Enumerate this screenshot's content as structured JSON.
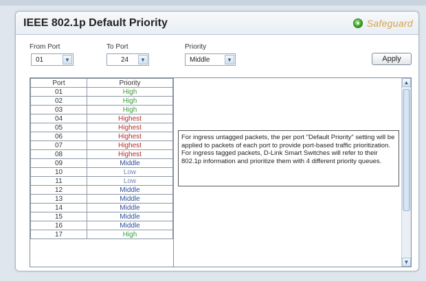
{
  "title": "IEEE 802.1p Default Priority",
  "safeguard_label": "Safeguard",
  "form": {
    "from_port_label": "From Port",
    "from_port_value": "01",
    "to_port_label": "To Port",
    "to_port_value": "24",
    "priority_label": "Priority",
    "priority_value": "Middle",
    "apply_label": "Apply"
  },
  "table": {
    "headers": [
      "Port",
      "Priority"
    ],
    "rows": [
      {
        "port": "01",
        "priority": "High"
      },
      {
        "port": "02",
        "priority": "High"
      },
      {
        "port": "03",
        "priority": "High"
      },
      {
        "port": "04",
        "priority": "Highest"
      },
      {
        "port": "05",
        "priority": "Highest"
      },
      {
        "port": "06",
        "priority": "Highest"
      },
      {
        "port": "07",
        "priority": "Highest"
      },
      {
        "port": "08",
        "priority": "Highest"
      },
      {
        "port": "09",
        "priority": "Middle"
      },
      {
        "port": "10",
        "priority": "Low"
      },
      {
        "port": "11",
        "priority": "Low"
      },
      {
        "port": "12",
        "priority": "Middle"
      },
      {
        "port": "13",
        "priority": "Middle"
      },
      {
        "port": "14",
        "priority": "Middle"
      },
      {
        "port": "15",
        "priority": "Middle"
      },
      {
        "port": "16",
        "priority": "Middle"
      },
      {
        "port": "17",
        "priority": "High"
      }
    ]
  },
  "info": {
    "line1": "For ingress untagged packets, the per port \"Default Priority\" setting will be applied to packets of each port to provide port-based traffic prioritization.",
    "line2": "For ingress tagged packets, D-Link Smart Switches will refer to their 802.1p information and prioritize them with 4 different priority queues."
  },
  "colors": {
    "High": "#3b9b3b",
    "Highest": "#b52a2a",
    "Middle": "#2d4f9a",
    "Low": "#6e86b8"
  },
  "icons": {
    "dropdown": "chevron-down-icon",
    "status": "status-dot-icon",
    "scroll_up": "chevron-up-icon",
    "scroll_down": "chevron-down-icon"
  }
}
